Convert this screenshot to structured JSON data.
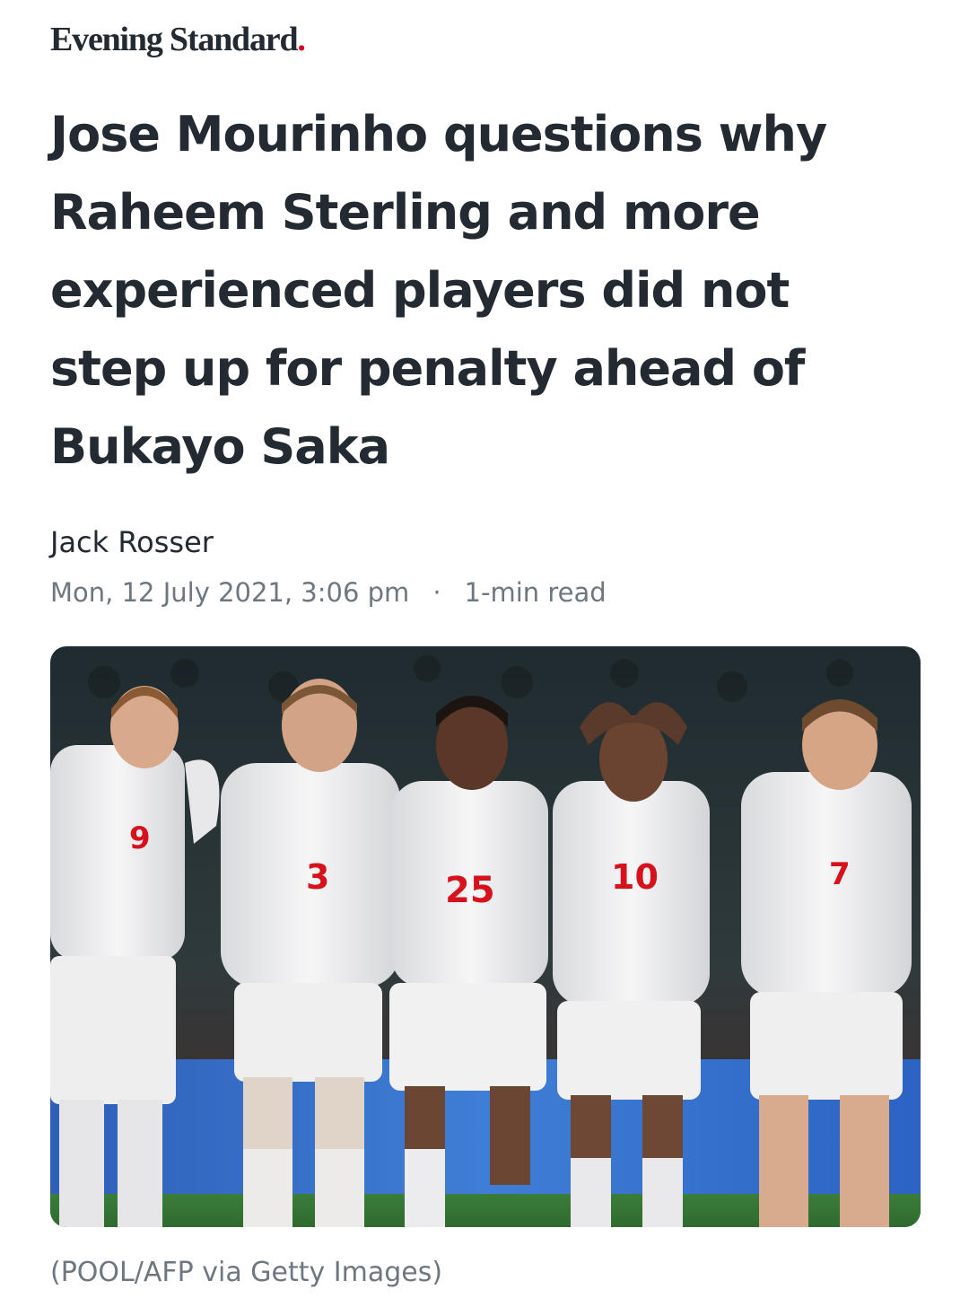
{
  "publisher": {
    "name": "Evening Standard",
    "dot": "."
  },
  "article": {
    "headline": "Jose Mourinho questions why Raheem Sterling and more experienced players did not step up for penalty ahead of Bukayo Saka",
    "author": "Jack Rosser",
    "date": "Mon, 12 July 2021, 3:06 pm",
    "separator": "·",
    "read_time": "1-min read"
  },
  "image": {
    "shirt_numbers": [
      "9",
      "3",
      "25",
      "10",
      "7"
    ],
    "caption": "(POOL/AFP via Getty Images)"
  },
  "colors": {
    "brand_dot": "#d6001c",
    "text": "#232a31",
    "meta": "#6e7780"
  }
}
